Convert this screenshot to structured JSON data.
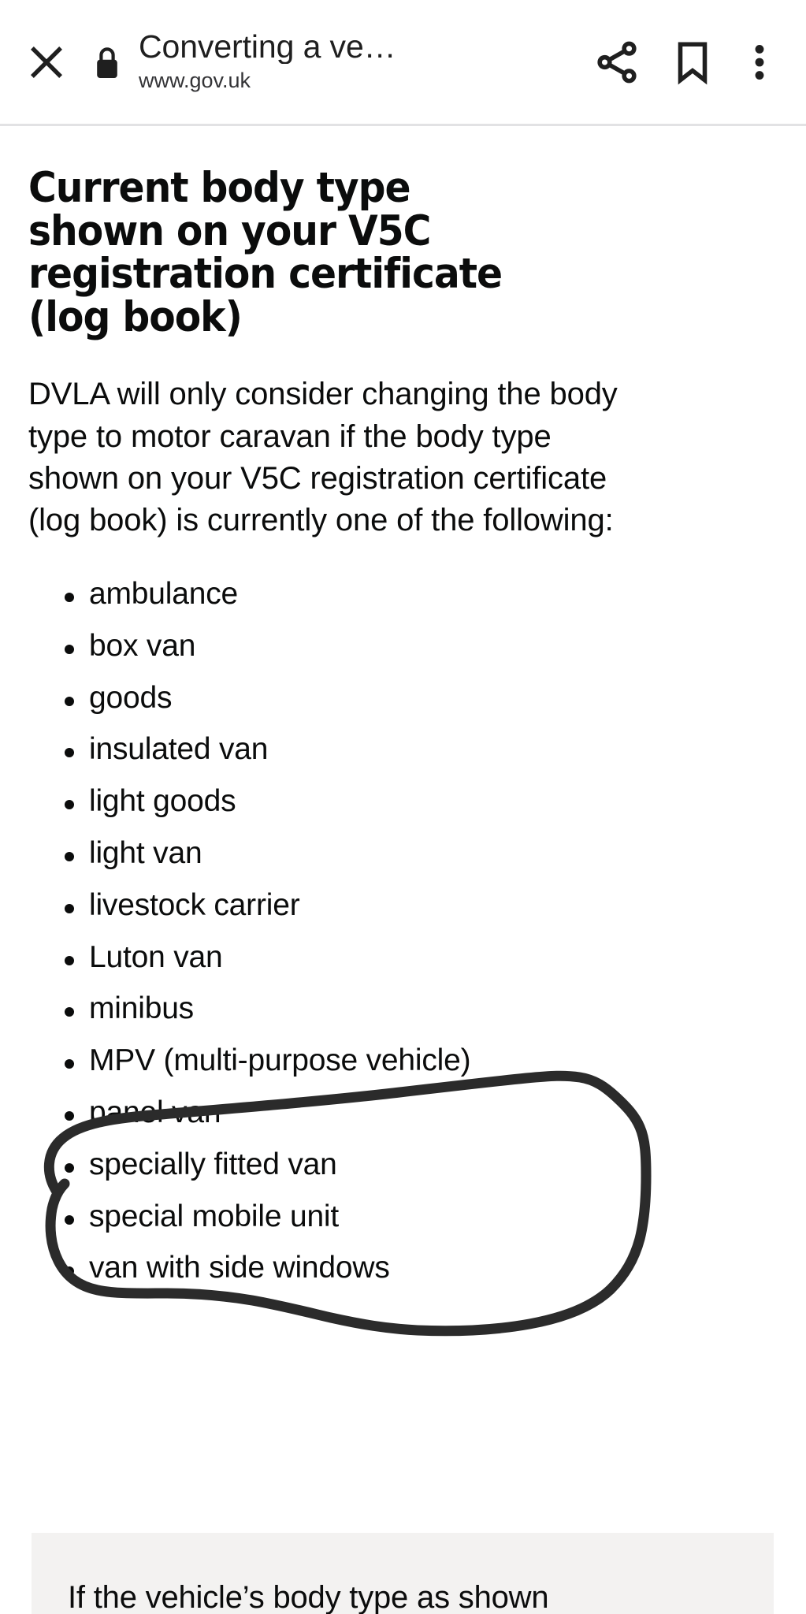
{
  "browser": {
    "close_label": "Close",
    "security_icon": "lock-icon",
    "title": "Converting a ve…",
    "url": "www.gov.uk",
    "actions": [
      {
        "name": "share-button",
        "label": "Share"
      },
      {
        "name": "bookmark-button",
        "label": "Bookmark"
      },
      {
        "name": "overflow-menu-button",
        "label": "More options"
      }
    ]
  },
  "document": {
    "heading": "Current body type shown on your V5C registration certificate (log book)",
    "intro": "DVLA will only consider changing the body type to motor caravan if the body type shown on your V5C registration certificate (log book) is currently one of the following:",
    "body_types": [
      "ambulance",
      "box van",
      "goods",
      "insulated van",
      "light goods",
      "light van",
      "livestock carrier",
      "Luton van",
      "minibus",
      "MPV (multi-purpose vehicle)",
      "panel van",
      "specially fitted van",
      "special mobile unit",
      "van with side windows"
    ],
    "inset_text": "If the vehicle’s body type as shown"
  },
  "annotation": {
    "type": "hand-drawn-circle",
    "target": "MPV (multi-purpose vehicle)",
    "color": "#2b2b2b"
  },
  "colors": {
    "text": "#0b0c0c",
    "background": "#ffffff",
    "inset_background": "#f3f2f1",
    "divider": "#e2e2e4",
    "icon": "#1f1f1f"
  }
}
